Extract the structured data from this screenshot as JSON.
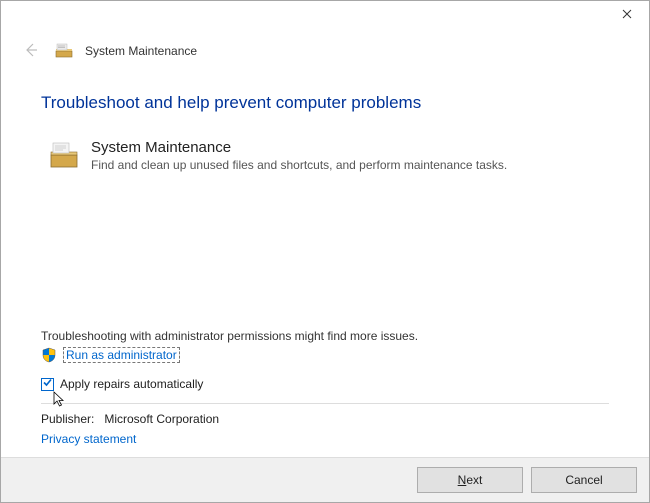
{
  "header": {
    "title": "System Maintenance"
  },
  "page": {
    "title": "Troubleshoot and help prevent computer problems"
  },
  "section": {
    "title": "System Maintenance",
    "desc": "Find and clean up unused files and shortcuts, and perform maintenance tasks."
  },
  "admin": {
    "note": "Troubleshooting with administrator permissions might find more issues.",
    "link": "Run as administrator"
  },
  "checkbox": {
    "label": "Apply repairs automatically",
    "checked": true
  },
  "publisher": {
    "label": "Publisher:",
    "value": "Microsoft Corporation"
  },
  "privacy": {
    "label": "Privacy statement"
  },
  "buttons": {
    "next": "Next",
    "cancel": "Cancel"
  }
}
